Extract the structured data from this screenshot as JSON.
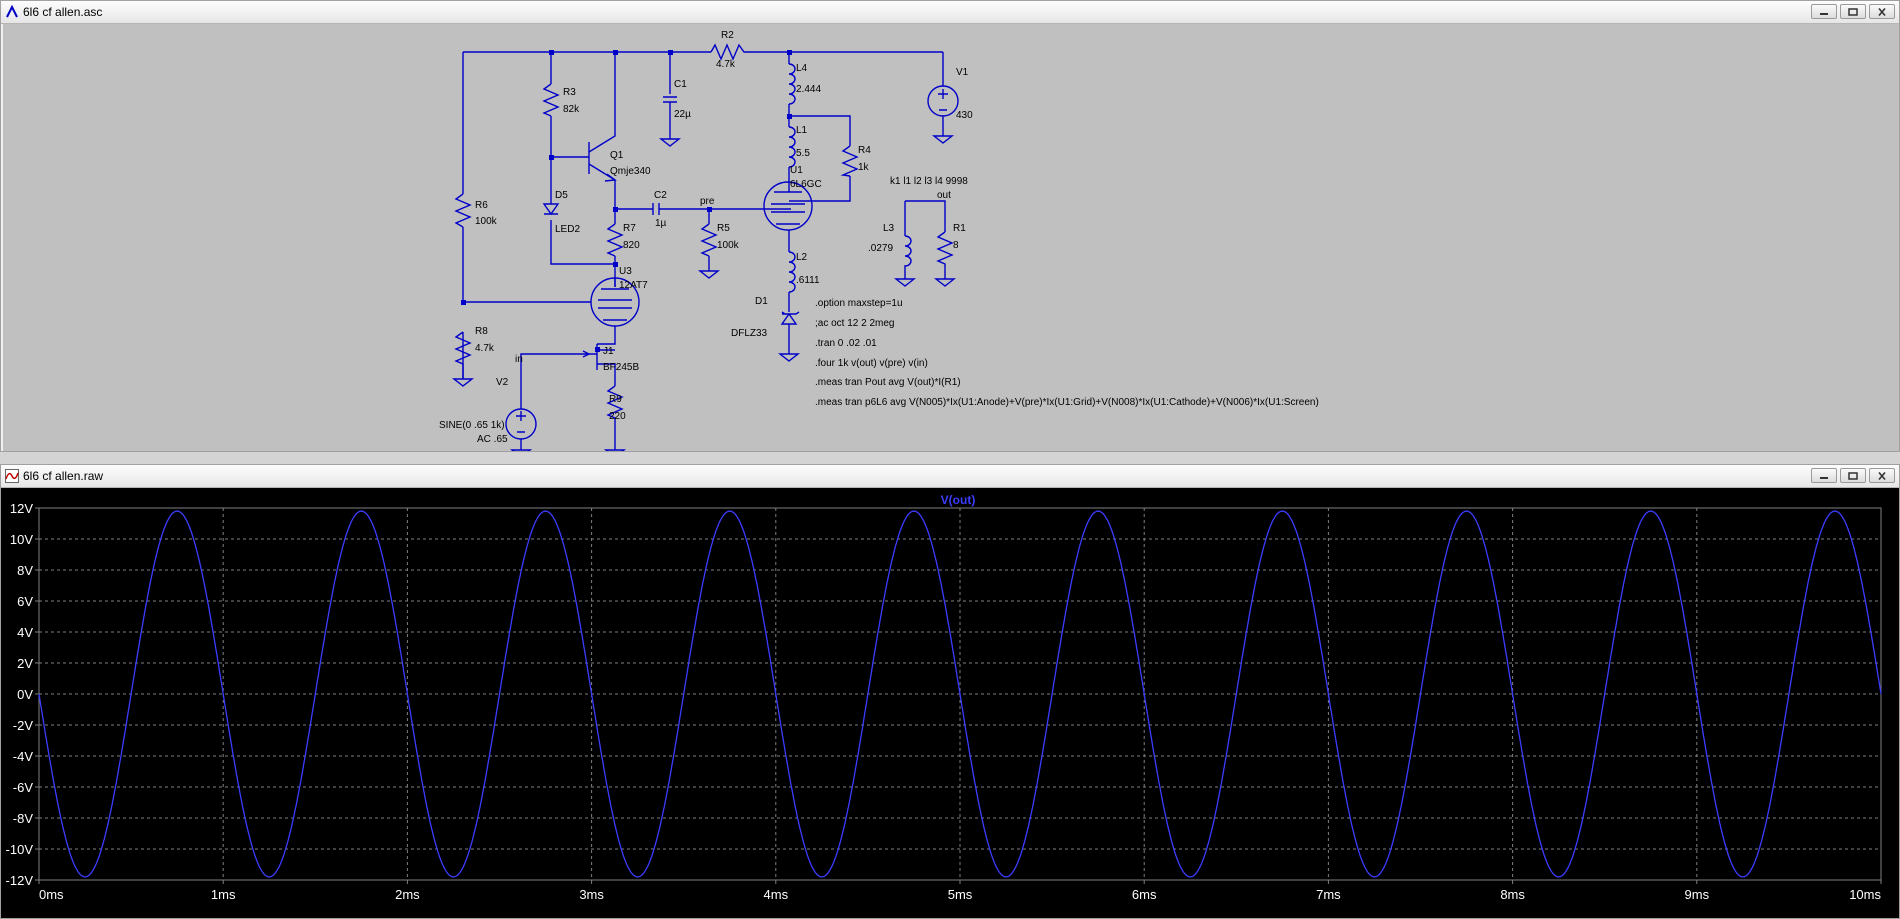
{
  "schematic_window": {
    "title": "6l6 cf allen.asc",
    "components": {
      "R2": {
        "name": "R2",
        "value": "4.7k"
      },
      "L4": {
        "name": "L4",
        "value": "2.444"
      },
      "V1": {
        "name": "V1",
        "value": "430"
      },
      "R3": {
        "name": "R3",
        "value": "82k"
      },
      "C1": {
        "name": "C1",
        "value": "22µ"
      },
      "L1": {
        "name": "L1",
        "value": "5.5"
      },
      "R4": {
        "name": "R4",
        "value": "1k"
      },
      "Q1": {
        "name": "Q1",
        "value": "Qmje340"
      },
      "U1": {
        "name": "U1",
        "value": "6L6GC"
      },
      "D5": {
        "name": "D5",
        "value": "LED2"
      },
      "C2": {
        "name": "C2",
        "value": "1µ"
      },
      "R6": {
        "name": "R6",
        "value": "100k"
      },
      "R7": {
        "name": "R7",
        "value": "820"
      },
      "R5": {
        "name": "R5",
        "value": "100k"
      },
      "L3": {
        "name": "L3",
        "value": ".0279"
      },
      "R1": {
        "name": "R1",
        "value": "8"
      },
      "U3": {
        "name": "U3",
        "value": "12AT7"
      },
      "L2": {
        "name": "L2",
        "value": ".6111"
      },
      "D1": {
        "name": "D1",
        "value": "DFLZ33"
      },
      "R8": {
        "name": "R8",
        "value": "4.7k"
      },
      "J1": {
        "name": "J1",
        "value": "BF245B"
      },
      "V2": {
        "name": "V2",
        "value": "SINE(0 .65 1k)",
        "value2": "AC .65"
      },
      "R9": {
        "name": "R9",
        "value": "220"
      }
    },
    "net_labels": {
      "pre": "pre",
      "out": "out",
      "in": "in"
    },
    "coupling": "k1 l1 l2 l3 l4 9998",
    "directives": [
      ".option maxstep=1u",
      ";ac oct 12 2 2meg",
      ".tran 0 .02 .01",
      ".four 1k v(out) v(pre) v(in)",
      ".meas tran Pout avg V(out)*I(R1)",
      ".meas tran p6L6 avg V(N005)*Ix(U1:Anode)+V(pre)*Ix(U1:Grid)+V(N008)*Ix(U1:Cathode)+V(N006)*Ix(U1:Screen)"
    ]
  },
  "plot_window": {
    "title": "6l6 cf allen.raw",
    "trace_label": "V(out)"
  },
  "chart_data": {
    "type": "line",
    "title": "V(out)",
    "xlabel": "",
    "ylabel": "",
    "x_unit": "ms",
    "y_unit": "V",
    "xlim": [
      0,
      10
    ],
    "ylim": [
      -12,
      12
    ],
    "x_ticks": [
      "0ms",
      "1ms",
      "2ms",
      "3ms",
      "4ms",
      "5ms",
      "6ms",
      "7ms",
      "8ms",
      "9ms",
      "10ms"
    ],
    "y_ticks": [
      "12V",
      "10V",
      "8V",
      "6V",
      "4V",
      "2V",
      "0V",
      "-2V",
      "-4V",
      "-6V",
      "-8V",
      "-10V",
      "-12V"
    ],
    "grid": true,
    "series": [
      {
        "name": "V(out)",
        "color": "#3c3cff",
        "waveform": "sine",
        "amplitude": 11.8,
        "frequency_khz": 1,
        "phase_deg": 180,
        "x_start": 0,
        "x_end": 10
      }
    ]
  },
  "colors": {
    "wire": "#0000c8",
    "plot_bg": "#000000",
    "trace": "#3c3cff",
    "grid": "#808080",
    "axis_text": "#ffffff",
    "schematic_bg": "#c0c0c0"
  }
}
